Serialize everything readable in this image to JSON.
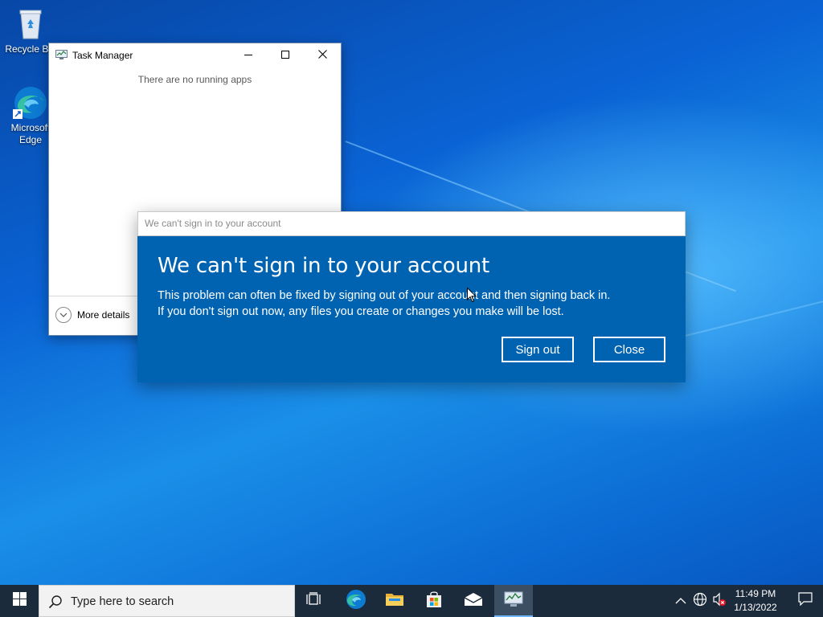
{
  "desktop": {
    "icons": [
      {
        "label": "Recycle Bin",
        "icon": "recycle-bin-icon"
      },
      {
        "label": "Microsoft Edge",
        "icon": "edge-icon"
      }
    ]
  },
  "task_manager": {
    "title": "Task Manager",
    "empty_message": "There are no running apps",
    "more_details_label": "More details",
    "controls": [
      "minimize-icon",
      "maximize-icon",
      "close-icon"
    ]
  },
  "dialog": {
    "window_title": "We can't sign in to your account",
    "heading": "We can't sign in to your account",
    "message_line1": "This problem can often be fixed by signing out of your account and then signing back in.",
    "message_line2": "If you don't sign out now, any files you create or changes you make will be lost.",
    "sign_out_label": "Sign out",
    "close_label": "Close",
    "accent_color": "#0063b1"
  },
  "taskbar": {
    "search_placeholder": "Type here to search",
    "pinned": [
      "task-view-icon",
      "edge-icon",
      "file-explorer-icon",
      "microsoft-store-icon",
      "mail-icon",
      "task-manager-icon"
    ],
    "active_item": "task-manager-icon",
    "tray": [
      "show-hidden-icons-icon",
      "network-icon",
      "volume-muted-icon"
    ],
    "clock_time": "11:49 PM",
    "clock_date": "1/13/2022"
  }
}
